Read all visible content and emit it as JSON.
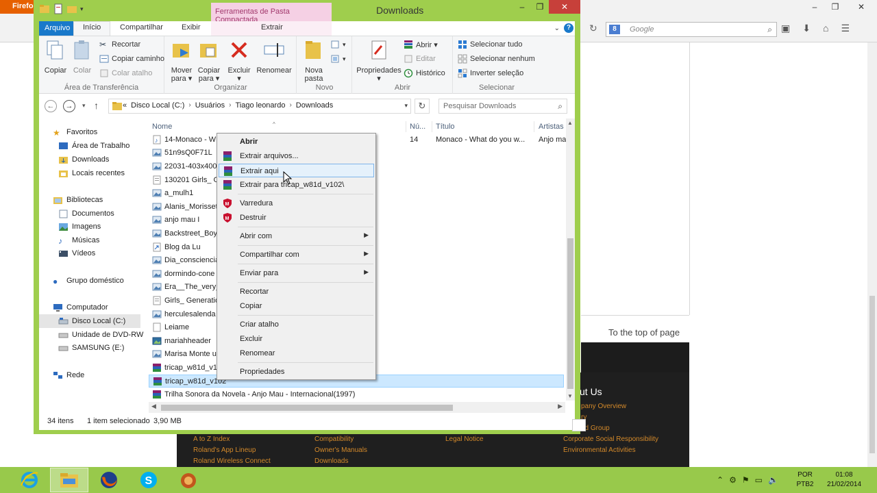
{
  "firefox": {
    "app_label": "Firefo",
    "search_placeholder": "Google",
    "search_engine_letter": "8",
    "to_top_link": "To the top of page",
    "footer": {
      "heading": "ut Us",
      "col1": [
        "A to Z Index",
        "Roland's App Lineup",
        "Roland Wireless Connect"
      ],
      "col2": [
        "Compatibility",
        "Owner's Manuals",
        "Downloads"
      ],
      "col3": [
        "Legal Notice"
      ],
      "col4": [
        "pany Overview",
        "ry",
        "nd Group",
        "Corporate Social Responsibility",
        "Environmental Activities"
      ]
    }
  },
  "window": {
    "title": "Downloads",
    "contextual_tab_header": "Ferramentas de Pasta Compactada"
  },
  "ribbon": {
    "tabs": {
      "arquivo": "Arquivo",
      "inicio": "Início",
      "compartilhar": "Compartilhar",
      "exibir": "Exibir",
      "extrair": "Extrair"
    },
    "groups": {
      "clipboard": {
        "label": "Área de Transferência",
        "copiar": "Copiar",
        "colar": "Colar",
        "recortar": "Recortar",
        "copiar_caminho": "Copiar caminho",
        "colar_atalho": "Colar atalho"
      },
      "organize": {
        "label": "Organizar",
        "mover_1": "Mover",
        "mover_2": "para ▾",
        "copiar_1": "Copiar",
        "copiar_2": "para ▾",
        "excluir_1": "Excluir",
        "excluir_2": "▾",
        "renomear": "Renomear"
      },
      "new": {
        "label": "Novo",
        "nova_1": "Nova",
        "nova_2": "pasta"
      },
      "open": {
        "label": "Abrir",
        "propriedades": "Propriedades",
        "propriedades_arrow": "▾",
        "abrir": "Abrir ▾",
        "editar": "Editar",
        "historico": "Histórico"
      },
      "select": {
        "label": "Selecionar",
        "tudo": "Selecionar tudo",
        "nenhum": "Selecionar nenhum",
        "inverter": "Inverter seleção"
      }
    }
  },
  "address": {
    "overflow": "«",
    "crumbs": [
      "Disco Local (C:)",
      "Usuários",
      "Tiago leonardo",
      "Downloads"
    ],
    "search_placeholder": "Pesquisar Downloads"
  },
  "navpane": {
    "favoritos": "Favoritos",
    "area_de_trabalho": "Área de Trabalho",
    "downloads": "Downloads",
    "locais_recentes": "Locais recentes",
    "bibliotecas": "Bibliotecas",
    "documentos": "Documentos",
    "imagens": "Imagens",
    "musicas": "Músicas",
    "videos": "Vídeos",
    "grupo_domestico": "Grupo doméstico",
    "computador": "Computador",
    "disco_local": "Disco Local (C:)",
    "dvd": "Unidade de DVD-RW",
    "samsung": "SAMSUNG (E:)",
    "rede": "Rede"
  },
  "columns": {
    "nome": "Nome",
    "numero": "Nú...",
    "titulo": "Título",
    "artistas": "Artistas"
  },
  "files": [
    {
      "name": "14-Monaco - W",
      "num": "14",
      "title": "Monaco - What do you w...",
      "artist": "Anjo ma"
    },
    {
      "name": "51n9sQ0F71L"
    },
    {
      "name": "22031-403x400"
    },
    {
      "name": "130201 Girls_ Ge"
    },
    {
      "name": "a_mulh1"
    },
    {
      "name": "Alanis_Morisset"
    },
    {
      "name": "anjo mau I"
    },
    {
      "name": "Backstreet_Boy"
    },
    {
      "name": "Blog da Lu"
    },
    {
      "name": "Dia_consciencia"
    },
    {
      "name": "dormindo-cone"
    },
    {
      "name": "Era__The_very_"
    },
    {
      "name": "Girls_ Generatio"
    },
    {
      "name": "herculesalenda"
    },
    {
      "name": "Leiame"
    },
    {
      "name": "mariahheader"
    },
    {
      "name": "Marisa Monte u"
    },
    {
      "name": "tricap_w81d_v1"
    },
    {
      "name": "tricap_w81d_v102"
    },
    {
      "name": "Trilha Sonora da  Novela - Anjo Mau - Internacional(1997)"
    }
  ],
  "context_menu": {
    "abrir": "Abrir",
    "extrair_arquivos": "Extrair arquivos...",
    "extrair_aqui": "Extrair aqui",
    "extrair_para": "Extrair para tricap_w81d_v102\\",
    "varredura": "Varredura",
    "destruir": "Destruir",
    "abrir_com": "Abrir com",
    "compartilhar_com": "Compartilhar com",
    "enviar_para": "Enviar para",
    "recortar": "Recortar",
    "copiar": "Copiar",
    "criar_atalho": "Criar atalho",
    "excluir": "Excluir",
    "renomear": "Renomear",
    "propriedades": "Propriedades"
  },
  "status": {
    "count": "34 itens",
    "selection": "1 item selecionado",
    "size": "3,90 MB"
  },
  "taskbar": {
    "lang_1": "POR",
    "lang_2": "PTB2",
    "time": "01:08",
    "date": "21/02/2014"
  },
  "colors": {
    "window_frame": "#9fce4d",
    "taskbar": "#98c94b",
    "arquivo_tab": "#1979ca",
    "contextual_tab": "#f5d0e4",
    "selection": "#cce8ff",
    "menu_highlight": "#e5f1fb"
  }
}
